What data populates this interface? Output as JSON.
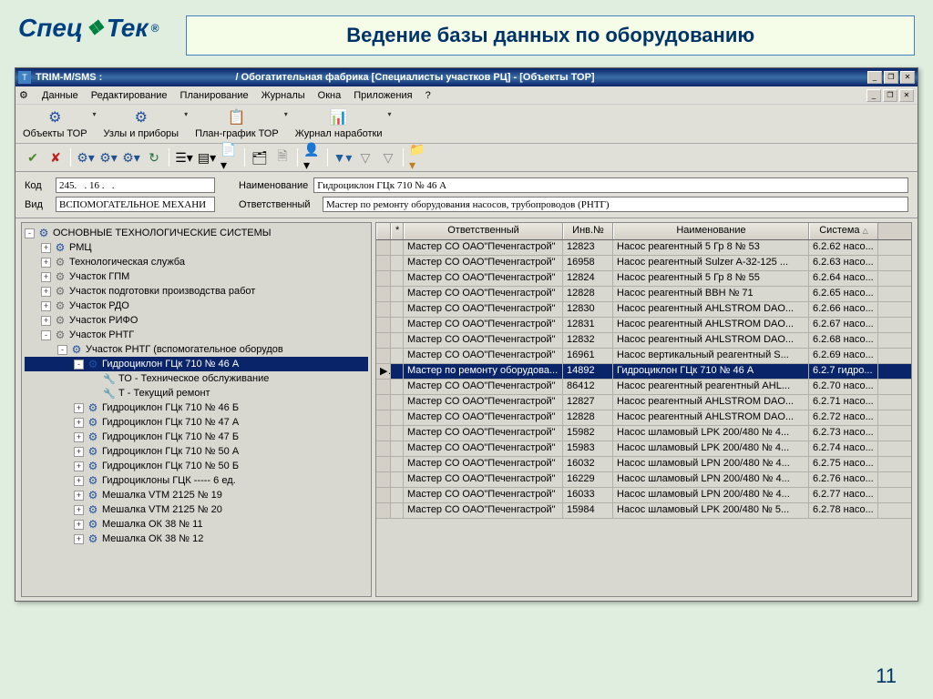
{
  "logo": {
    "part1": "Спец",
    "part2": "Тек",
    "icon": "❖",
    "reg": "®"
  },
  "slide_title": "Ведение базы данных по оборудованию",
  "page_number": "11",
  "titlebar": {
    "app": "TRIM-M/SMS :",
    "context": "/ Обогатительная фабрика  [Специалисты участков РЦ] - [Объекты ТОР]"
  },
  "menu": [
    "Данные",
    "Редактирование",
    "Планирование",
    "Журналы",
    "Окна",
    "Приложения",
    "?"
  ],
  "main_toolbar": [
    {
      "label": "Объекты ТОР",
      "icon": "⚙"
    },
    {
      "label": "Узлы и приборы",
      "icon": "⚙"
    },
    {
      "label": "План-график ТОР",
      "icon": "📋"
    },
    {
      "label": "Журнал наработки",
      "icon": "📊"
    }
  ],
  "filters": {
    "code_label": "Код",
    "code_value": "245.   . 16 .   .",
    "name_label": "Наименование",
    "name_value": "Гидроциклон ГЦк 710 № 46 А",
    "type_label": "Вид",
    "type_value": "ВСПОМОГАТЕЛЬНОЕ МЕХАНИ",
    "resp_label": "Ответственный",
    "resp_value": "Мастер по ремонту оборудования насосов, трубопроводов (РНТГ)"
  },
  "tree": [
    {
      "d": 0,
      "e": "-",
      "i": "gear-blue",
      "t": "ОСНОВНЫЕ ТЕХНОЛОГИЧЕСКИЕ СИСТЕМЫ"
    },
    {
      "d": 1,
      "e": "+",
      "i": "gear-blue",
      "t": "РМЦ"
    },
    {
      "d": 1,
      "e": "+",
      "i": "gear-gray",
      "t": "Технологическая служба"
    },
    {
      "d": 1,
      "e": "+",
      "i": "gear-gray",
      "t": "Участок ГПМ"
    },
    {
      "d": 1,
      "e": "+",
      "i": "gear-gray",
      "t": "Участок подготовки производства работ"
    },
    {
      "d": 1,
      "e": "+",
      "i": "gear-gray",
      "t": "Участок РДО"
    },
    {
      "d": 1,
      "e": "+",
      "i": "gear-gray",
      "t": "Участок РИФО"
    },
    {
      "d": 1,
      "e": "-",
      "i": "gear-gray",
      "t": "Участок РНТГ"
    },
    {
      "d": 2,
      "e": "-",
      "i": "gear-blue",
      "t": "Участок РНТГ (вспомогательное оборудов"
    },
    {
      "d": 3,
      "e": "-",
      "i": "gear-blue",
      "t": "Гидроциклон ГЦк 710 № 46 А",
      "sel": true
    },
    {
      "d": 4,
      "e": " ",
      "i": "tool",
      "t": "ТО - Техническое обслуживание"
    },
    {
      "d": 4,
      "e": " ",
      "i": "tool",
      "t": "Т -  Текущий ремонт"
    },
    {
      "d": 3,
      "e": "+",
      "i": "gear-blue",
      "t": "Гидроциклон ГЦк 710 № 46 Б"
    },
    {
      "d": 3,
      "e": "+",
      "i": "gear-blue",
      "t": "Гидроциклон ГЦк 710 № 47 А"
    },
    {
      "d": 3,
      "e": "+",
      "i": "gear-blue",
      "t": "Гидроциклон ГЦк 710 № 47 Б"
    },
    {
      "d": 3,
      "e": "+",
      "i": "gear-blue",
      "t": "Гидроциклон ГЦк 710 № 50 А"
    },
    {
      "d": 3,
      "e": "+",
      "i": "gear-blue",
      "t": "Гидроциклон ГЦк 710 № 50 Б"
    },
    {
      "d": 3,
      "e": "+",
      "i": "gear-blue",
      "t": "Гидроциклоны ГЦК ----- 6 ед."
    },
    {
      "d": 3,
      "e": "+",
      "i": "gear-blue",
      "t": "Мешалка VTM 2125 № 19"
    },
    {
      "d": 3,
      "e": "+",
      "i": "gear-blue",
      "t": "Мешалка VTM 2125 № 20"
    },
    {
      "d": 3,
      "e": "+",
      "i": "gear-blue",
      "t": "Мешалка ОК 38 № 11"
    },
    {
      "d": 3,
      "e": "+",
      "i": "gear-blue",
      "t": "Мешалка ОК 38 № 12"
    }
  ],
  "grid": {
    "headers": {
      "resp": "Ответственный",
      "inv": "Инв.№",
      "name": "Наименование",
      "sys": "Система"
    },
    "rows": [
      {
        "r": "Мастер СО ОАО\"Печенгастрой\"",
        "i": "12823",
        "n": "Насос реагентный 5 Гр 8 № 53",
        "s": "6.2.62 насо..."
      },
      {
        "r": "Мастер СО ОАО\"Печенгастрой\"",
        "i": "16958",
        "n": "Насос реагентный Sulzer A-32-125 ...",
        "s": "6.2.63 насо..."
      },
      {
        "r": "Мастер СО ОАО\"Печенгастрой\"",
        "i": "12824",
        "n": "Насос реагентный 5 Гр 8 № 55",
        "s": "6.2.64 насо..."
      },
      {
        "r": "Мастер СО ОАО\"Печенгастрой\"",
        "i": "12828",
        "n": "Насос реагентный ВВН № 71",
        "s": "6.2.65 насо..."
      },
      {
        "r": "Мастер СО ОАО\"Печенгастрой\"",
        "i": "12830",
        "n": "Насос реагентный AHLSTROM DAO...",
        "s": "6.2.66 насо..."
      },
      {
        "r": "Мастер СО ОАО\"Печенгастрой\"",
        "i": "12831",
        "n": "Насос реагентный AHLSTROM DAO...",
        "s": "6.2.67 насо..."
      },
      {
        "r": "Мастер СО ОАО\"Печенгастрой\"",
        "i": "12832",
        "n": "Насос реагентный AHLSTROM DAO...",
        "s": "6.2.68 насо..."
      },
      {
        "r": "Мастер СО ОАО\"Печенгастрой\"",
        "i": "16961",
        "n": "Насос вертикальный реагентный S...",
        "s": "6.2.69 насо..."
      },
      {
        "r": "Мастер по ремонту оборудова...",
        "i": "14892",
        "n": "Гидроциклон ГЦк 710 № 46 А",
        "s": "6.2.7 гидро...",
        "sel": true,
        "mark": "▶"
      },
      {
        "r": "Мастер СО ОАО\"Печенгастрой\"",
        "i": "86412",
        "n": "Насос реагентный реагентный AHL...",
        "s": "6.2.70 насо..."
      },
      {
        "r": "Мастер СО ОАО\"Печенгастрой\"",
        "i": "12827",
        "n": "Насос реагентный AHLSTROM DAO...",
        "s": "6.2.71 насо..."
      },
      {
        "r": "Мастер СО ОАО\"Печенгастрой\"",
        "i": "12828",
        "n": "Насос реагентный AHLSTROM DAO...",
        "s": "6.2.72 насо..."
      },
      {
        "r": "Мастер СО ОАО\"Печенгастрой\"",
        "i": "15982",
        "n": "Насос шламовый LPK 200/480 № 4...",
        "s": "6.2.73 насо..."
      },
      {
        "r": "Мастер СО ОАО\"Печенгастрой\"",
        "i": "15983",
        "n": "Насос шламовый LPK 200/480 № 4...",
        "s": "6.2.74 насо..."
      },
      {
        "r": "Мастер СО ОАО\"Печенгастрой\"",
        "i": "16032",
        "n": "Насос шламовый LPN 200/480 № 4...",
        "s": "6.2.75 насо..."
      },
      {
        "r": "Мастер СО ОАО\"Печенгастрой\"",
        "i": "16229",
        "n": "Насос шламовый LPN 200/480 № 4...",
        "s": "6.2.76 насо..."
      },
      {
        "r": "Мастер СО ОАО\"Печенгастрой\"",
        "i": "16033",
        "n": "Насос шламовый LPN 200/480 № 4...",
        "s": "6.2.77 насо..."
      },
      {
        "r": "Мастер СО ОАО\"Печенгастрой\"",
        "i": "15984",
        "n": "Насос шламовый LPK 200/480 № 5...",
        "s": "6.2.78 насо..."
      }
    ]
  }
}
